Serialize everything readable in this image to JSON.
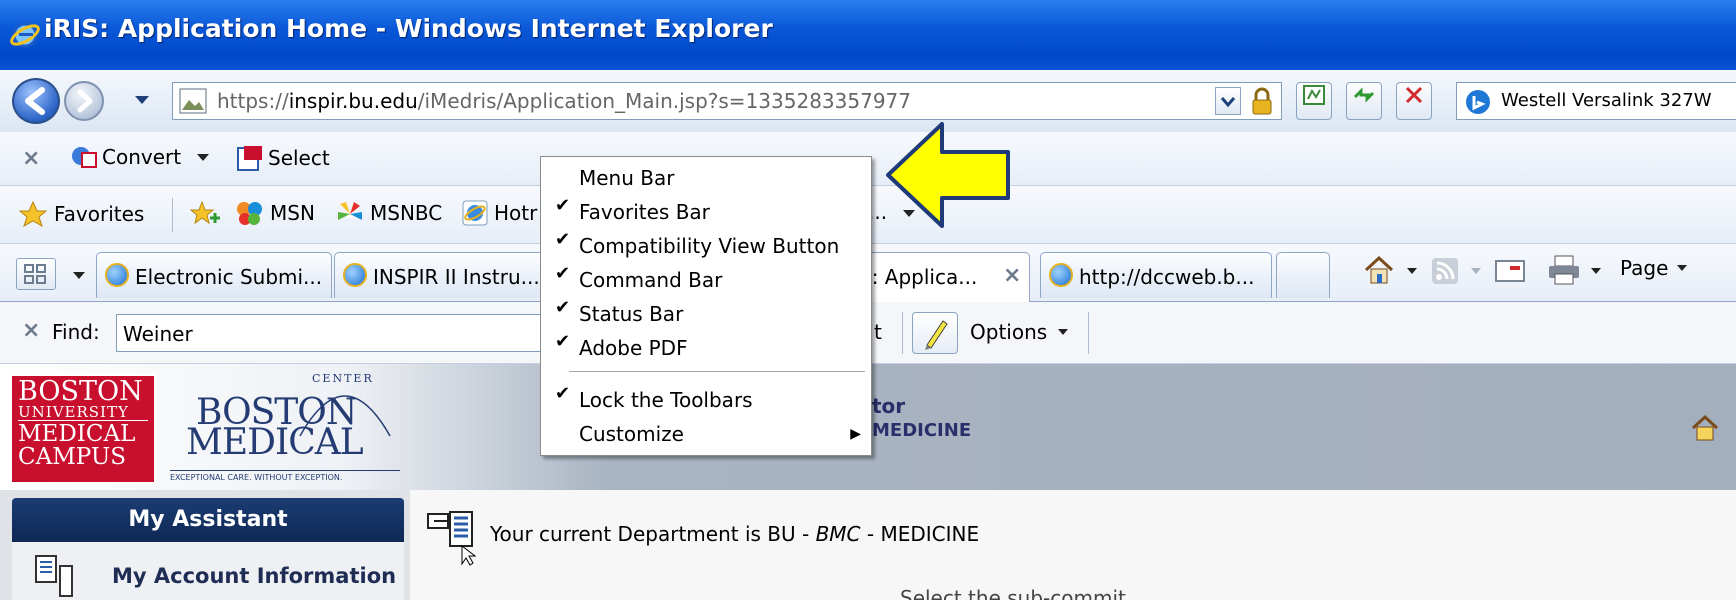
{
  "window": {
    "title": "iRIS: Application Home - Windows Internet Explorer"
  },
  "address_bar": {
    "url_prefix": "https://",
    "url_host": "inspir.bu.edu",
    "url_path": "/iMedris/Application_Main.jsp?s=1335283357977"
  },
  "search_box": {
    "provider_text": "Westell Versalink 327W"
  },
  "command_toolbar": {
    "convert_label": "Convert",
    "select_label": "Select"
  },
  "favorites_bar": {
    "favorites_label": "Favorites",
    "links": [
      "MSN",
      "MSNBC",
      "Hotr"
    ],
    "overflow": "..."
  },
  "tabs": [
    {
      "label": "Electronic Submi..."
    },
    {
      "label": "INSPIR II Instru..."
    },
    {
      "label": "S: Applica..."
    },
    {
      "label": "http://dccweb.b..."
    }
  ],
  "right_toolbar": {
    "page_label": "Page"
  },
  "find_bar": {
    "find_label": "Find:",
    "find_value": "Weiner",
    "partial_label": "t",
    "options_label": "Options"
  },
  "context_menu": {
    "items": [
      {
        "label": "Menu Bar",
        "checked": ""
      },
      {
        "label": "Favorites Bar",
        "checked": "✔"
      },
      {
        "label": "Compatibility View Button",
        "checked": "✔"
      },
      {
        "label": "Command Bar",
        "checked": "✔"
      },
      {
        "label": "Status Bar",
        "checked": "✔"
      },
      {
        "label": "Adobe PDF",
        "checked": "✔"
      },
      {
        "label": "Lock the Toolbars",
        "checked": "✔"
      },
      {
        "label": "Customize",
        "checked": "",
        "submenu": "▶"
      }
    ]
  },
  "page_header": {
    "bu_logo_lines": [
      "BOSTON",
      "UNIVERSITY",
      "MEDICAL",
      "CAMPUS"
    ],
    "bmc_logo_top": "BOSTON",
    "bmc_logo_bottom": "MEDICAL",
    "bmc_logo_center": "CENTER",
    "bmc_tagline": "EXCEPTIONAL CARE. WITHOUT EXCEPTION.",
    "role_partial": "tor",
    "dept_partial": "MEDICINE"
  },
  "sidebar": {
    "heading": "My Assistant",
    "item1": "My Account Information"
  },
  "content": {
    "dept_prefix": "Your current Department is BU - ",
    "dept_italic": "BMC",
    "dept_suffix": " - MEDICINE",
    "partial_line": "Select the sub-commit"
  },
  "colors": {
    "arrow_fill": "#ffff00",
    "titlebar": "#0a58d8",
    "bu_red": "#c8102e",
    "sidebar_head": "#1b3c72"
  }
}
